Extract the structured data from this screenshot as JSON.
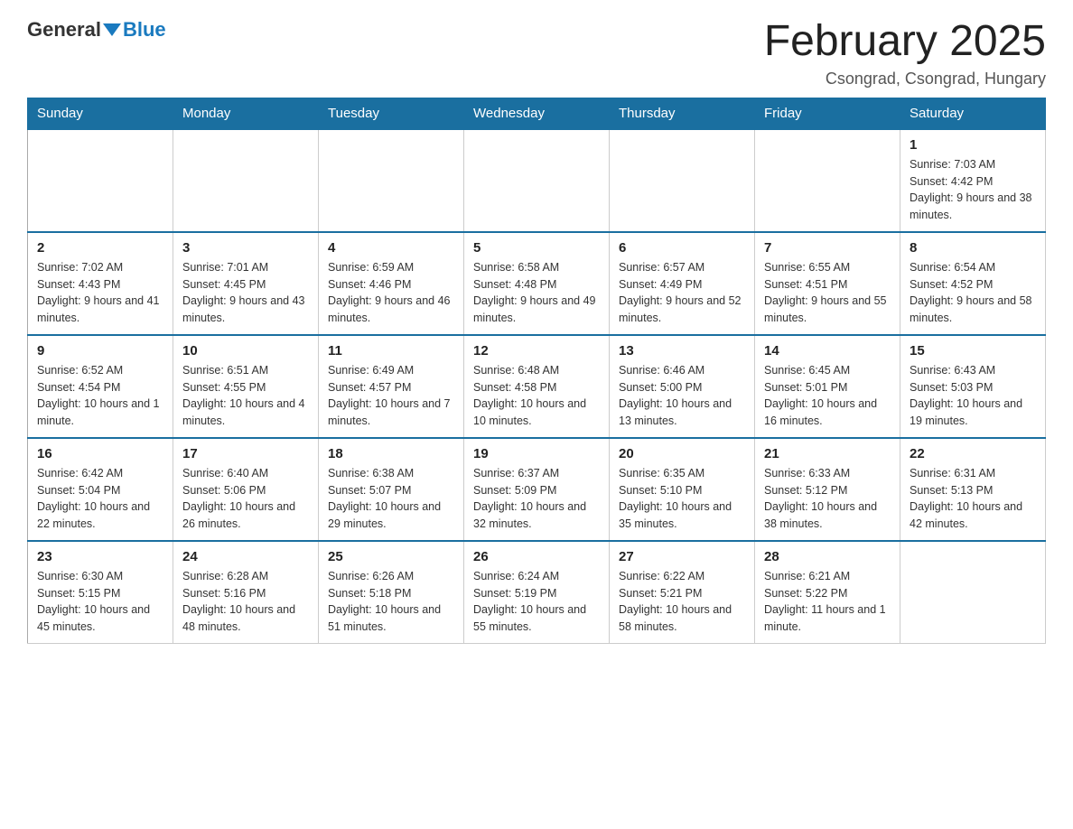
{
  "header": {
    "logo_general": "General",
    "logo_blue": "Blue",
    "month_title": "February 2025",
    "location": "Csongrad, Csongrad, Hungary"
  },
  "weekdays": [
    "Sunday",
    "Monday",
    "Tuesday",
    "Wednesday",
    "Thursday",
    "Friday",
    "Saturday"
  ],
  "weeks": [
    [
      {
        "day": "",
        "info": ""
      },
      {
        "day": "",
        "info": ""
      },
      {
        "day": "",
        "info": ""
      },
      {
        "day": "",
        "info": ""
      },
      {
        "day": "",
        "info": ""
      },
      {
        "day": "",
        "info": ""
      },
      {
        "day": "1",
        "info": "Sunrise: 7:03 AM\nSunset: 4:42 PM\nDaylight: 9 hours and 38 minutes."
      }
    ],
    [
      {
        "day": "2",
        "info": "Sunrise: 7:02 AM\nSunset: 4:43 PM\nDaylight: 9 hours and 41 minutes."
      },
      {
        "day": "3",
        "info": "Sunrise: 7:01 AM\nSunset: 4:45 PM\nDaylight: 9 hours and 43 minutes."
      },
      {
        "day": "4",
        "info": "Sunrise: 6:59 AM\nSunset: 4:46 PM\nDaylight: 9 hours and 46 minutes."
      },
      {
        "day": "5",
        "info": "Sunrise: 6:58 AM\nSunset: 4:48 PM\nDaylight: 9 hours and 49 minutes."
      },
      {
        "day": "6",
        "info": "Sunrise: 6:57 AM\nSunset: 4:49 PM\nDaylight: 9 hours and 52 minutes."
      },
      {
        "day": "7",
        "info": "Sunrise: 6:55 AM\nSunset: 4:51 PM\nDaylight: 9 hours and 55 minutes."
      },
      {
        "day": "8",
        "info": "Sunrise: 6:54 AM\nSunset: 4:52 PM\nDaylight: 9 hours and 58 minutes."
      }
    ],
    [
      {
        "day": "9",
        "info": "Sunrise: 6:52 AM\nSunset: 4:54 PM\nDaylight: 10 hours and 1 minute."
      },
      {
        "day": "10",
        "info": "Sunrise: 6:51 AM\nSunset: 4:55 PM\nDaylight: 10 hours and 4 minutes."
      },
      {
        "day": "11",
        "info": "Sunrise: 6:49 AM\nSunset: 4:57 PM\nDaylight: 10 hours and 7 minutes."
      },
      {
        "day": "12",
        "info": "Sunrise: 6:48 AM\nSunset: 4:58 PM\nDaylight: 10 hours and 10 minutes."
      },
      {
        "day": "13",
        "info": "Sunrise: 6:46 AM\nSunset: 5:00 PM\nDaylight: 10 hours and 13 minutes."
      },
      {
        "day": "14",
        "info": "Sunrise: 6:45 AM\nSunset: 5:01 PM\nDaylight: 10 hours and 16 minutes."
      },
      {
        "day": "15",
        "info": "Sunrise: 6:43 AM\nSunset: 5:03 PM\nDaylight: 10 hours and 19 minutes."
      }
    ],
    [
      {
        "day": "16",
        "info": "Sunrise: 6:42 AM\nSunset: 5:04 PM\nDaylight: 10 hours and 22 minutes."
      },
      {
        "day": "17",
        "info": "Sunrise: 6:40 AM\nSunset: 5:06 PM\nDaylight: 10 hours and 26 minutes."
      },
      {
        "day": "18",
        "info": "Sunrise: 6:38 AM\nSunset: 5:07 PM\nDaylight: 10 hours and 29 minutes."
      },
      {
        "day": "19",
        "info": "Sunrise: 6:37 AM\nSunset: 5:09 PM\nDaylight: 10 hours and 32 minutes."
      },
      {
        "day": "20",
        "info": "Sunrise: 6:35 AM\nSunset: 5:10 PM\nDaylight: 10 hours and 35 minutes."
      },
      {
        "day": "21",
        "info": "Sunrise: 6:33 AM\nSunset: 5:12 PM\nDaylight: 10 hours and 38 minutes."
      },
      {
        "day": "22",
        "info": "Sunrise: 6:31 AM\nSunset: 5:13 PM\nDaylight: 10 hours and 42 minutes."
      }
    ],
    [
      {
        "day": "23",
        "info": "Sunrise: 6:30 AM\nSunset: 5:15 PM\nDaylight: 10 hours and 45 minutes."
      },
      {
        "day": "24",
        "info": "Sunrise: 6:28 AM\nSunset: 5:16 PM\nDaylight: 10 hours and 48 minutes."
      },
      {
        "day": "25",
        "info": "Sunrise: 6:26 AM\nSunset: 5:18 PM\nDaylight: 10 hours and 51 minutes."
      },
      {
        "day": "26",
        "info": "Sunrise: 6:24 AM\nSunset: 5:19 PM\nDaylight: 10 hours and 55 minutes."
      },
      {
        "day": "27",
        "info": "Sunrise: 6:22 AM\nSunset: 5:21 PM\nDaylight: 10 hours and 58 minutes."
      },
      {
        "day": "28",
        "info": "Sunrise: 6:21 AM\nSunset: 5:22 PM\nDaylight: 11 hours and 1 minute."
      },
      {
        "day": "",
        "info": ""
      }
    ]
  ]
}
